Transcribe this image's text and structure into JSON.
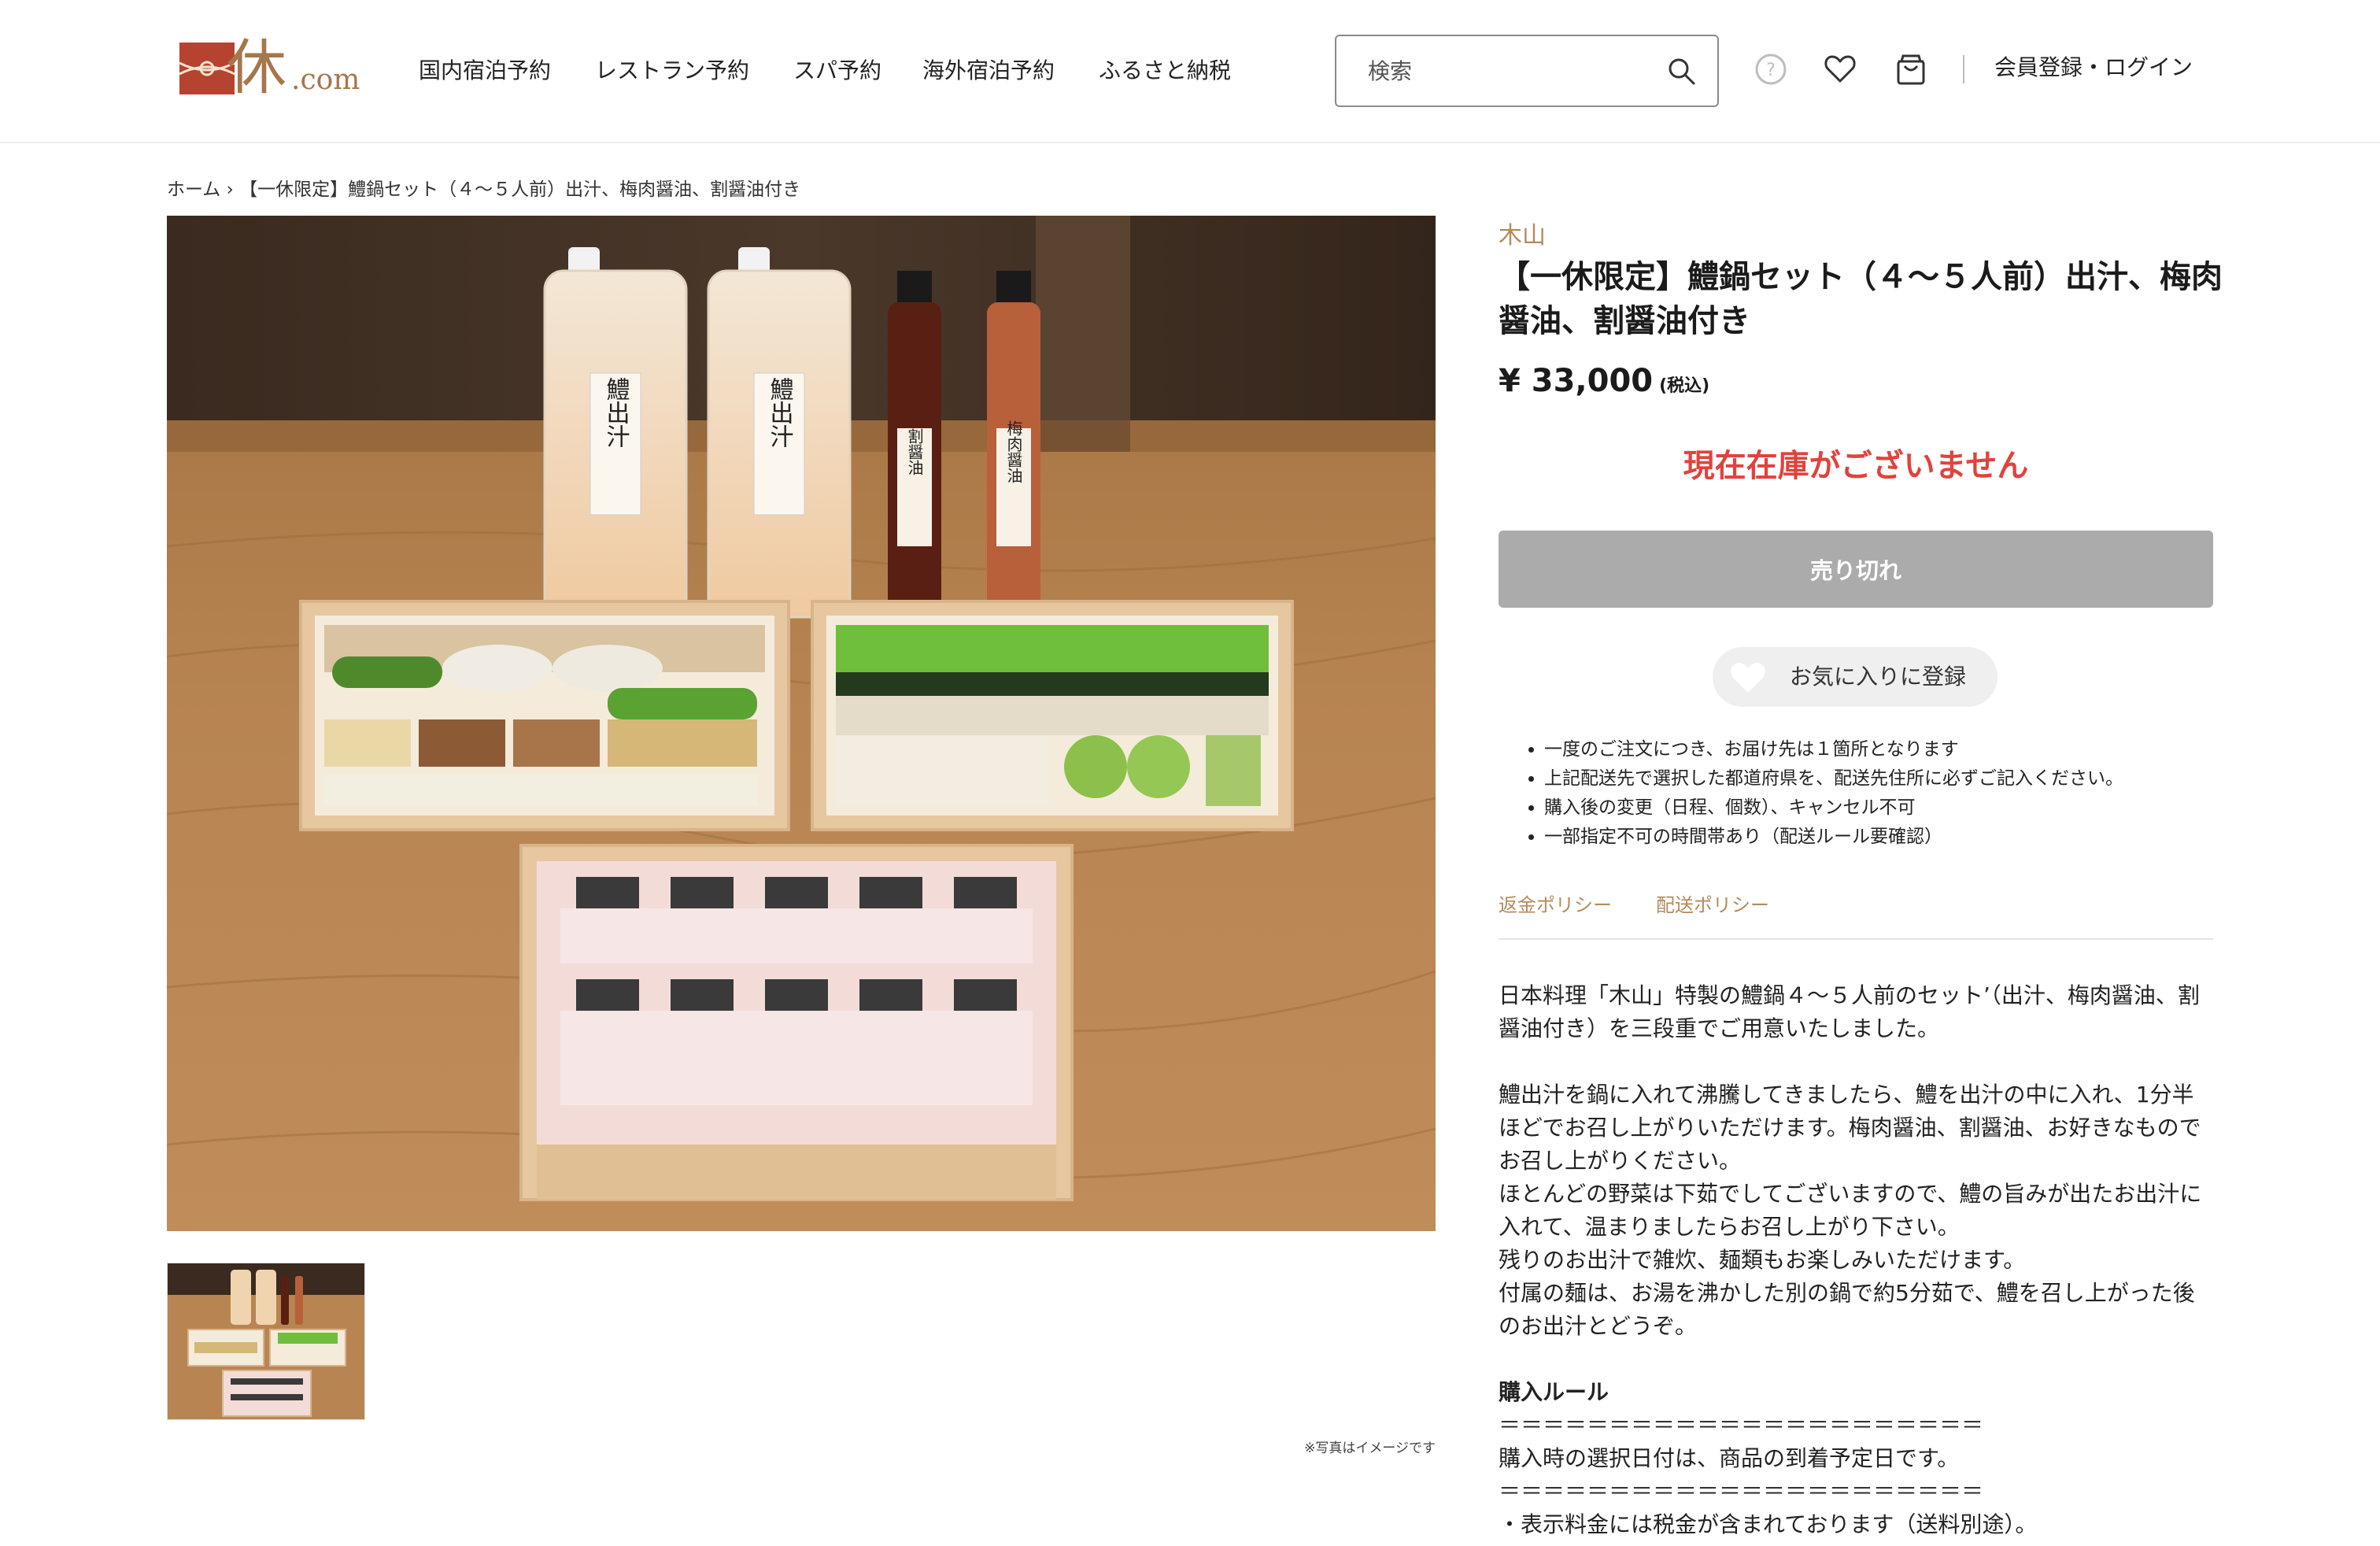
{
  "header": {
    "logo_text": "休",
    "logo_suffix": ".com",
    "nav": [
      "国内宿泊予約",
      "レストラン予約",
      "スパ予約",
      "海外宿泊予約",
      "ふるさと納税"
    ],
    "search_placeholder": "検索",
    "login": "会員登録・ログイン"
  },
  "breadcrumb": {
    "home": "ホーム",
    "separator": "›",
    "current": "【一休限定】鱧鍋セット（４〜５人前）出汁、梅肉醤油、割醤油付き"
  },
  "gallery": {
    "note": "※写真はイメージです",
    "bottle_labels": [
      "鱧出汁",
      "鱧出汁",
      "割醤油",
      "梅肉醤油"
    ]
  },
  "product": {
    "vendor": "木山",
    "title": "【一休限定】鱧鍋セット（４〜５人前）出汁、梅肉醤油、割醤油付き",
    "price": "¥ 33,000",
    "tax_label": "(税込)",
    "stock_status": "現在在庫がございません",
    "soldout_button": "売り切れ",
    "favorite_button": "お気に入りに登録",
    "notes": [
      "一度のご注文につき、お届け先は１箇所となります",
      "上記配送先で選択した都道府県を、配送先住所に必ずご記入ください。",
      "購入後の変更（日程、個数）、キャンセル不可",
      "一部指定不可の時間帯あり（配送ルール要確認）"
    ],
    "policy_links": [
      "返金ポリシー",
      "配送ポリシー"
    ],
    "description": {
      "intro": "日本料理「木山」特製の鱧鍋４〜５人前のセット’（出汁、梅肉醤油、割醤油付き）を三段重でご用意いたしました。",
      "paragraphs": [
        "鱧出汁を鍋に入れて沸騰してきましたら、鱧を出汁の中に入れ、1分半ほどでお召し上がりいただけます。梅肉醤油、割醤油、お好きなものでお召し上がりください。",
        "ほとんどの野菜は下茹でしてございますので、鱧の旨みが出たお出汁に入れて、温まりましたらお召し上がり下さい。",
        "残りのお出汁で雑炊、麺類もお楽しみいただけます。",
        "付属の麺は、お湯を沸かした別の鍋で約5分茹で、鱧を召し上がった後のお出汁とどうぞ。"
      ]
    },
    "rules": {
      "heading": "購入ルール",
      "divider": "＝＝＝＝＝＝＝＝＝＝＝＝＝＝＝＝＝＝＝＝＝＝",
      "line1": "購入時の選択日付は、商品の到着予定日です。",
      "line2": "・表示料金には税金が含まれております（送料別途）。"
    }
  },
  "colors": {
    "accent_brown": "#b58a5a",
    "logo_red": "#b5432f",
    "stock_red": "#e0433d",
    "soldout_gray": "#ababab"
  }
}
